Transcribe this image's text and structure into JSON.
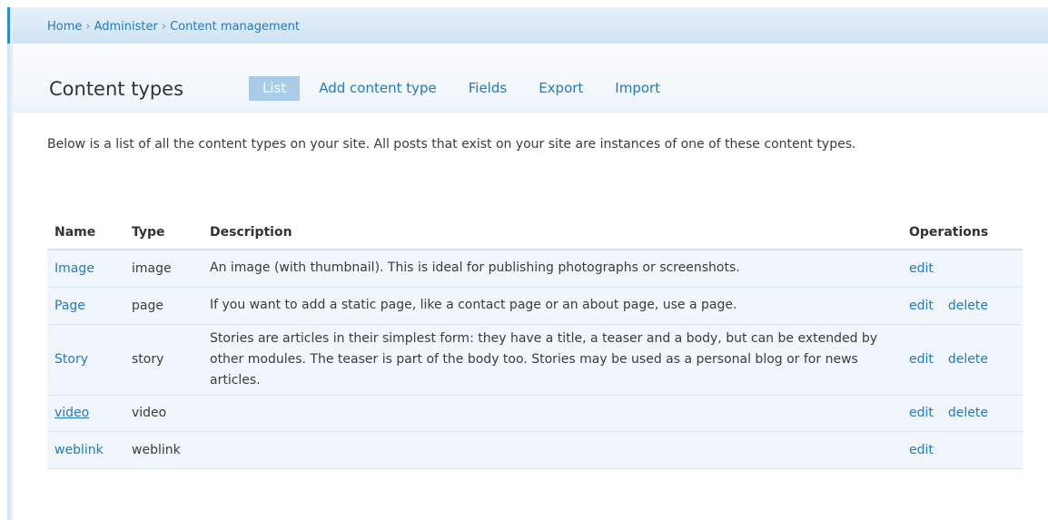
{
  "breadcrumb": {
    "items": [
      "Home",
      "Administer",
      "Content management"
    ],
    "separator": "›"
  },
  "page": {
    "title": "Content types"
  },
  "tabs": [
    {
      "label": "List",
      "active": true
    },
    {
      "label": "Add content type",
      "active": false
    },
    {
      "label": "Fields",
      "active": false
    },
    {
      "label": "Export",
      "active": false
    },
    {
      "label": "Import",
      "active": false
    }
  ],
  "intro": "Below is a list of all the content types on your site. All posts that exist on your site are instances of one of these content types.",
  "table": {
    "headers": {
      "name": "Name",
      "type": "Type",
      "description": "Description",
      "operations": "Operations"
    },
    "rows": [
      {
        "name": "Image",
        "type": "image",
        "description": "An image (with thumbnail). This is ideal for publishing photographs or screenshots.",
        "edit": "edit",
        "delete": ""
      },
      {
        "name": "Page",
        "type": "page",
        "description": "If you want to add a static page, like a contact page or an about page, use a page.",
        "edit": "edit",
        "delete": "delete"
      },
      {
        "name": "Story",
        "type": "story",
        "description": "Stories are articles in their simplest form: they have a title, a teaser and a body, but can be extended by other modules. The teaser is part of the body too. Stories may be used as a personal blog or for news articles.",
        "edit": "edit",
        "delete": "delete"
      },
      {
        "name": "video",
        "type": "video",
        "description": "",
        "edit": "edit",
        "delete": "delete"
      },
      {
        "name": "weblink",
        "type": "weblink",
        "description": "",
        "edit": "edit",
        "delete": ""
      }
    ]
  },
  "colors": {
    "link": "#2678c0",
    "active_tab_bg": "#a9cde9",
    "row_bg": "#f0f6fb",
    "accent": "#2a8bd1"
  }
}
